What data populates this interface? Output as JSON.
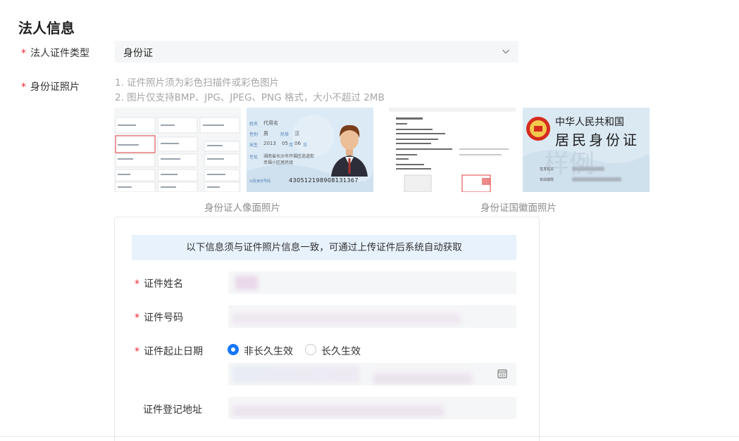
{
  "section": {
    "title": "法人信息"
  },
  "id_type": {
    "required_mark": "*",
    "label": "法人证件类型",
    "value": "身份证"
  },
  "id_photo": {
    "required_mark": "*",
    "label": "身份证照片",
    "hints": [
      "1. 证件照片须为彩色扫描件或彩色图片",
      "2. 图片仅支持BMP、JPG、JPEG、PNG 格式，大小不超过 2MB"
    ],
    "front_caption": "身份证人像面照片",
    "back_caption": "身份证国徽面照片",
    "sample_front": {
      "name_key": "姓名",
      "name_val": "代用名",
      "sex_key": "性别",
      "sex_val": "男",
      "nation_key": "民族",
      "nation_val": "汉",
      "birth_key": "出生",
      "birth_val": "2013",
      "birth_month": "05",
      "birth_month_unit": "月",
      "birth_day": "06",
      "birth_day_unit": "日",
      "addr_key": "住址",
      "addr_val1": "湖南省长沙市开福区巡道街",
      "addr_val2": "幸福小区居民组",
      "idno_key": "公民身份号码",
      "idno_val": "430512198908131367"
    },
    "sample_back": {
      "line1": "中华人民共和国",
      "line2": "居民身份证",
      "issuer_key": "签发机关",
      "valid_key": "有效期限"
    }
  },
  "form": {
    "banner": "以下信息须与证件照片信息一致，可通过上传证件后系统自动获取",
    "name_label": "证件姓名",
    "number_label": "证件号码",
    "validity_label": "证件起止日期",
    "radio_non_permanent": "非长久生效",
    "radio_permanent": "长久生效",
    "selected_radio": "非长久生效",
    "address_label": "证件登记地址",
    "required_mark": "*"
  },
  "colors": {
    "accent": "#1677ff",
    "required": "#f5222d",
    "banner_bg": "#e8f2fd",
    "input_bg": "#f5f6f7"
  },
  "icons": {
    "select": "chevron-down-icon",
    "date": "calendar-icon"
  }
}
